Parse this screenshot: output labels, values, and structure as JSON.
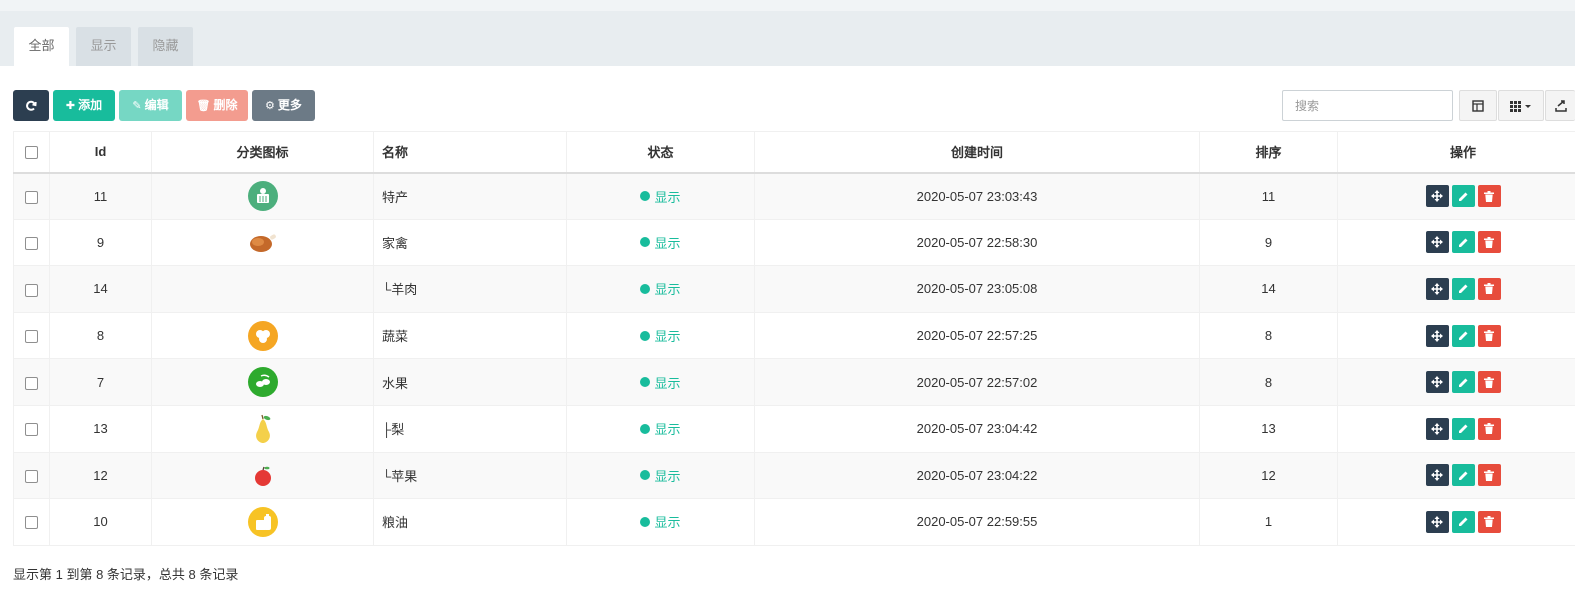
{
  "tabs": [
    {
      "label": "全部",
      "active": true
    },
    {
      "label": "显示",
      "active": false
    },
    {
      "label": "隐藏",
      "active": false
    }
  ],
  "toolbar": {
    "refresh_icon": "refresh-icon",
    "add_label": "添加",
    "edit_label": "编辑",
    "delete_label": "删除",
    "more_label": "更多",
    "colors": {
      "dark": "#2c3e50",
      "success": "#18bc9c",
      "success_light": "#76d7c4",
      "danger_light": "#f39c8f",
      "gray": "#6c7a86"
    }
  },
  "search": {
    "placeholder": "搜索",
    "value": ""
  },
  "table": {
    "headers": {
      "id": "Id",
      "icon": "分类图标",
      "name": "名称",
      "status": "状态",
      "created": "创建时间",
      "sort": "排序",
      "ops": "操作"
    },
    "rows": [
      {
        "id": "11",
        "icon": "specialty-icon",
        "name": "特产",
        "status": "显示",
        "created": "2020-05-07 23:03:43",
        "sort": "11"
      },
      {
        "id": "9",
        "icon": "roast-chicken-icon",
        "name": "家禽",
        "status": "显示",
        "created": "2020-05-07 22:58:30",
        "sort": "9"
      },
      {
        "id": "14",
        "icon": "",
        "name": "└羊肉",
        "status": "显示",
        "created": "2020-05-07 23:05:08",
        "sort": "14"
      },
      {
        "id": "8",
        "icon": "vegetable-icon",
        "name": "蔬菜",
        "status": "显示",
        "created": "2020-05-07 22:57:25",
        "sort": "8"
      },
      {
        "id": "7",
        "icon": "fruit-icon",
        "name": "水果",
        "status": "显示",
        "created": "2020-05-07 22:57:02",
        "sort": "8"
      },
      {
        "id": "13",
        "icon": "pear-icon",
        "name": "├梨",
        "status": "显示",
        "created": "2020-05-07 23:04:42",
        "sort": "13"
      },
      {
        "id": "12",
        "icon": "apple-icon",
        "name": "└苹果",
        "status": "显示",
        "created": "2020-05-07 23:04:22",
        "sort": "12"
      },
      {
        "id": "10",
        "icon": "grain-oil-icon",
        "name": "粮油",
        "status": "显示",
        "created": "2020-05-07 22:59:55",
        "sort": "1"
      }
    ]
  },
  "footer": {
    "text": "显示第 1 到第 8 条记录，总共 8 条记录"
  }
}
